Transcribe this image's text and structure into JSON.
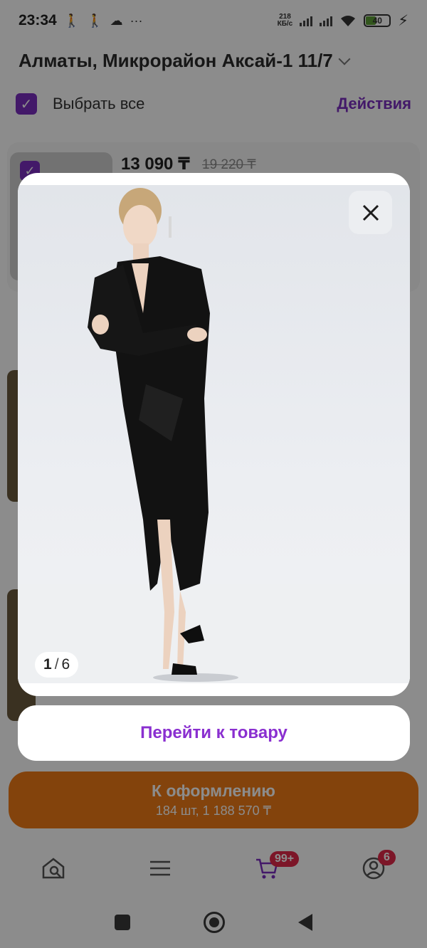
{
  "status_bar": {
    "time": "23:34",
    "ellipsis": "···",
    "net_speed_value": "218",
    "net_speed_unit": "КБ/с",
    "battery_level": "40",
    "battery_fraction": 0.4
  },
  "header": {
    "address": "Алматы, Микрорайон Аксай-1 11/7",
    "select_all_label": "Выбрать все",
    "actions_label": "Действия"
  },
  "cart": {
    "item_price": "13 090 ₸",
    "item_old_price": "19 220 ₸"
  },
  "checkout": {
    "title": "К оформлению",
    "summary": "184 шт, 1 188 570 ₸"
  },
  "bottom_nav": {
    "cart_badge": "99+",
    "profile_badge": "6"
  },
  "modal": {
    "image_index": "1",
    "image_total": "6",
    "goto_label": "Перейти к товару"
  }
}
